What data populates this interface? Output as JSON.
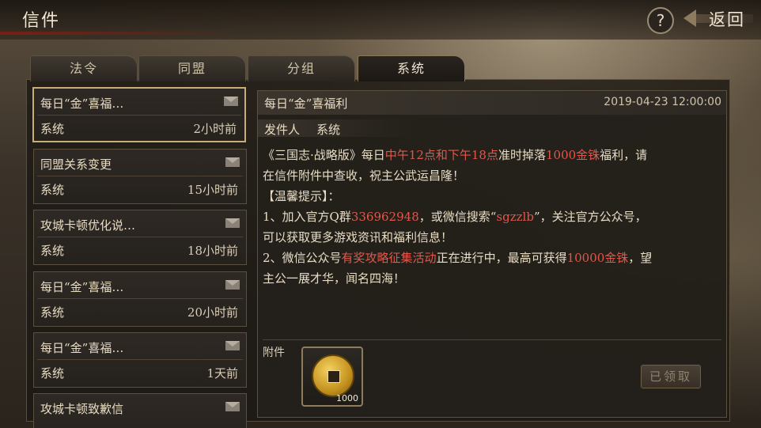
{
  "header": {
    "title": "信件",
    "help_label": "?",
    "back_label": "返回"
  },
  "tabs": [
    {
      "label": "法令",
      "active": false
    },
    {
      "label": "同盟",
      "active": false
    },
    {
      "label": "分组",
      "active": false
    },
    {
      "label": "系统",
      "active": true
    }
  ],
  "mail_list": [
    {
      "subject": "每日“金”喜福…",
      "sender": "系统",
      "time": "2小时前",
      "selected": true
    },
    {
      "subject": "同盟关系变更",
      "sender": "系统",
      "time": "15小时前",
      "selected": false
    },
    {
      "subject": "攻城卡顿优化说…",
      "sender": "系统",
      "time": "18小时前",
      "selected": false
    },
    {
      "subject": "每日“金”喜福…",
      "sender": "系统",
      "time": "20小时前",
      "selected": false
    },
    {
      "subject": "每日“金”喜福…",
      "sender": "系统",
      "time": "1天前",
      "selected": false
    },
    {
      "subject": "攻城卡顿致歉信",
      "sender": "",
      "time": "",
      "selected": false
    }
  ],
  "detail": {
    "subject": "每日“金”喜福利",
    "date": "2019-04-23 12:00:00",
    "sender_label": "发件人",
    "sender": "系统",
    "body": {
      "l1_a": "《三国志·战略版》每日",
      "l1_hl1": "中午12点和下午18点",
      "l1_b": "准时掉落",
      "l1_hl2": "1000金铢",
      "l1_c": "福利，请",
      "l2": "在信件附件中查收，祝主公武运昌隆！",
      "l3": "【温馨提示】：",
      "l4_a": "1、加入官方Q群",
      "l4_hl1": "336962948",
      "l4_b": "，或微信搜索“",
      "l4_hl2": "sgzzlb",
      "l4_c": "”，关注官方公众号，",
      "l5": "可以获取更多游戏资讯和福利信息！",
      "l6_a": "2、微信公众号",
      "l6_hl1": "有奖攻略征集活动",
      "l6_b": "正在进行中，最高可获得",
      "l6_hl2": "10000金铢",
      "l6_c": "，望",
      "l7": "主公一展才华，闻名四海！"
    },
    "attachment_label": "附件",
    "attachment": {
      "icon": "gold-coin-icon",
      "quantity": "1000"
    },
    "claimed_label": "已领取"
  },
  "colors": {
    "highlight": "#e2574c",
    "selected_border": "#c9ad76"
  }
}
